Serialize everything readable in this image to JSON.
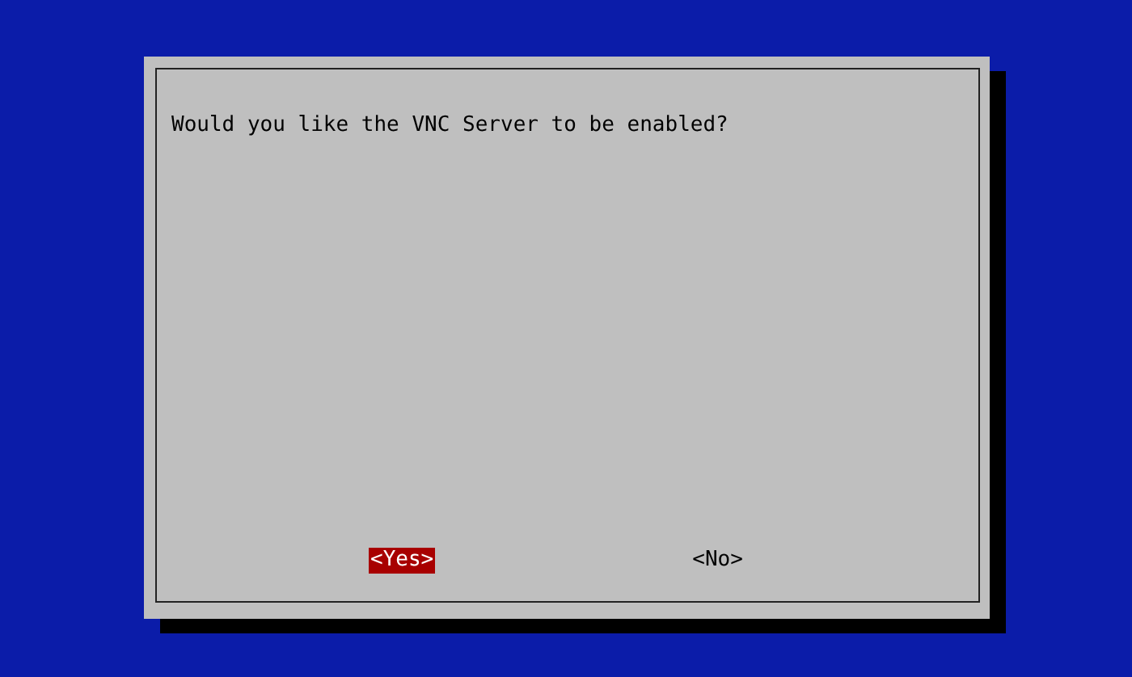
{
  "dialog": {
    "message": "Would you like the VNC Server to be enabled?",
    "buttons": [
      {
        "label": "<Yes>",
        "selected": true
      },
      {
        "label": "<No>",
        "selected": false
      }
    ]
  }
}
